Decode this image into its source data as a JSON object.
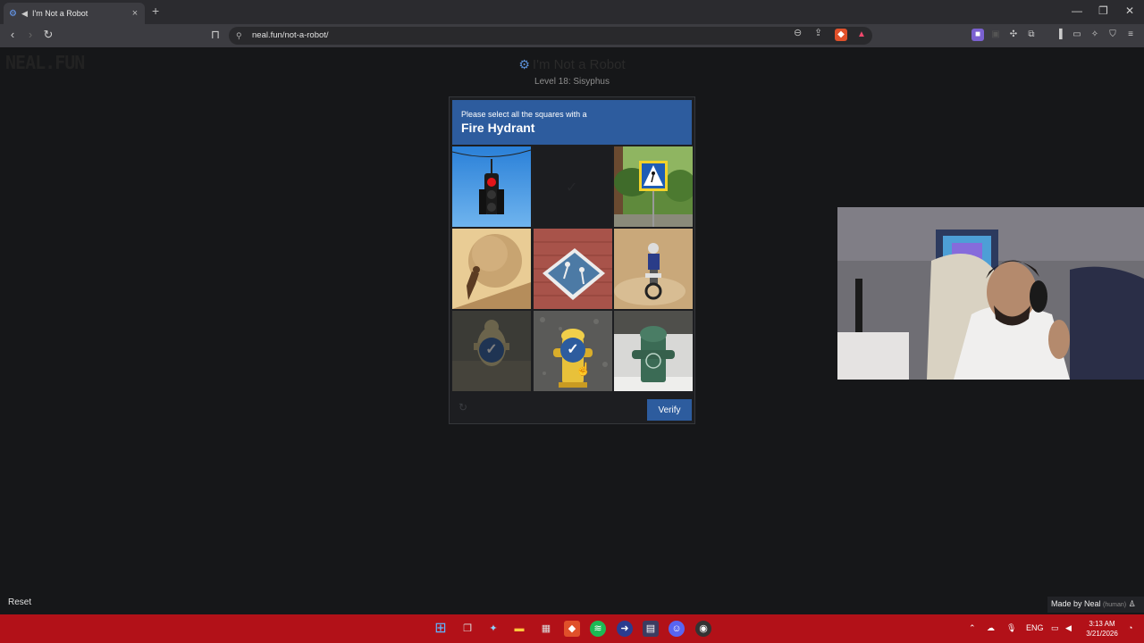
{
  "browser": {
    "tab_title": "I'm Not a Robot",
    "url": "neal.fun/not-a-robot/",
    "new_tab_label": "+",
    "close_tab_label": "×"
  },
  "page": {
    "logo": "NEAL.FUN",
    "title": "I'm Not a Robot",
    "level": "Level 18: Sisyphus"
  },
  "captcha": {
    "prompt": "Please select all the squares with a",
    "target": "Fire Hydrant",
    "verify_label": "Verify",
    "header_color": "#2d5c9e",
    "tiles": [
      {
        "subject": "traffic light",
        "selected": false
      },
      {
        "subject": "empty",
        "selected": false
      },
      {
        "subject": "pedestrian crossing sign",
        "selected": false
      },
      {
        "subject": "sisyphus boulder",
        "selected": false
      },
      {
        "subject": "pedestrian road marking",
        "selected": false
      },
      {
        "subject": "dirt bike rider",
        "selected": false
      },
      {
        "subject": "fire hydrant",
        "selected": true
      },
      {
        "subject": "yellow fire hydrant",
        "selected": true
      },
      {
        "subject": "green fire hydrant",
        "selected": false
      }
    ],
    "check_glyph": "✓"
  },
  "footer": {
    "reset_label": "Reset",
    "made_by": "Made by Neal",
    "made_by_note": "(human)"
  },
  "taskbar": {
    "lang": "ENG",
    "time": "3:13 AM",
    "date": "3/21/2026",
    "color": "#b21118"
  }
}
